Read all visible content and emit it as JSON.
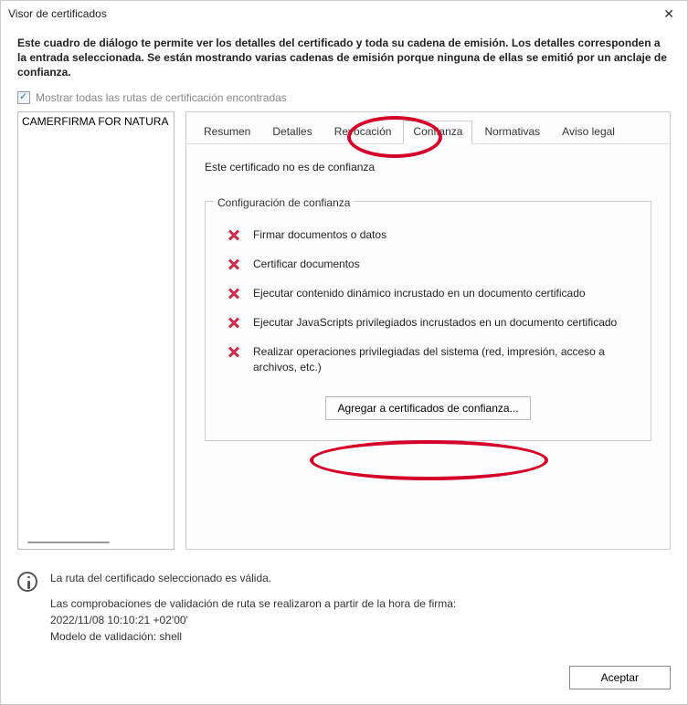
{
  "window": {
    "title": "Visor de certificados"
  },
  "intro_text": "Este cuadro de diálogo te permite ver los detalles del certificado y toda su cadena de emisión. Los detalles corresponden a la entrada seleccionada. Se están mostrando varias cadenas de emisión porque ninguna de ellas se emitió por un anclaje de confianza.",
  "checkbox": {
    "label": "Mostrar todas las rutas de certificación encontradas",
    "checked": true
  },
  "cert_list": {
    "items": [
      "CAMERFIRMA FOR NATURA"
    ]
  },
  "tabs": {
    "items": [
      "Resumen",
      "Detalles",
      "Revocación",
      "Confianza",
      "Normativas",
      "Aviso legal"
    ],
    "active_index": 3
  },
  "trust_tab": {
    "status_text": "Este certificado no es de confianza",
    "fieldset_label": "Configuración de confianza",
    "rows": [
      "Firmar documentos o datos",
      "Certificar documentos",
      "Ejecutar contenido dinámico incrustado en un documento certificado",
      "Ejecutar JavaScripts privilegiados incrustados en un documento certificado",
      "Realizar operaciones privilegiadas del sistema (red, impresión, acceso a archivos, etc.)"
    ],
    "add_button_label": "Agregar a certificados de confianza..."
  },
  "bottom": {
    "line1": "La ruta del certificado seleccionado es válida.",
    "line2": "Las comprobaciones de validación de ruta se realizaron a partir de la hora de firma:",
    "line3": "2022/11/08 10:10:21 +02'00'",
    "line4": "Modelo de validación: shell"
  },
  "footer": {
    "ok_label": "Aceptar"
  }
}
